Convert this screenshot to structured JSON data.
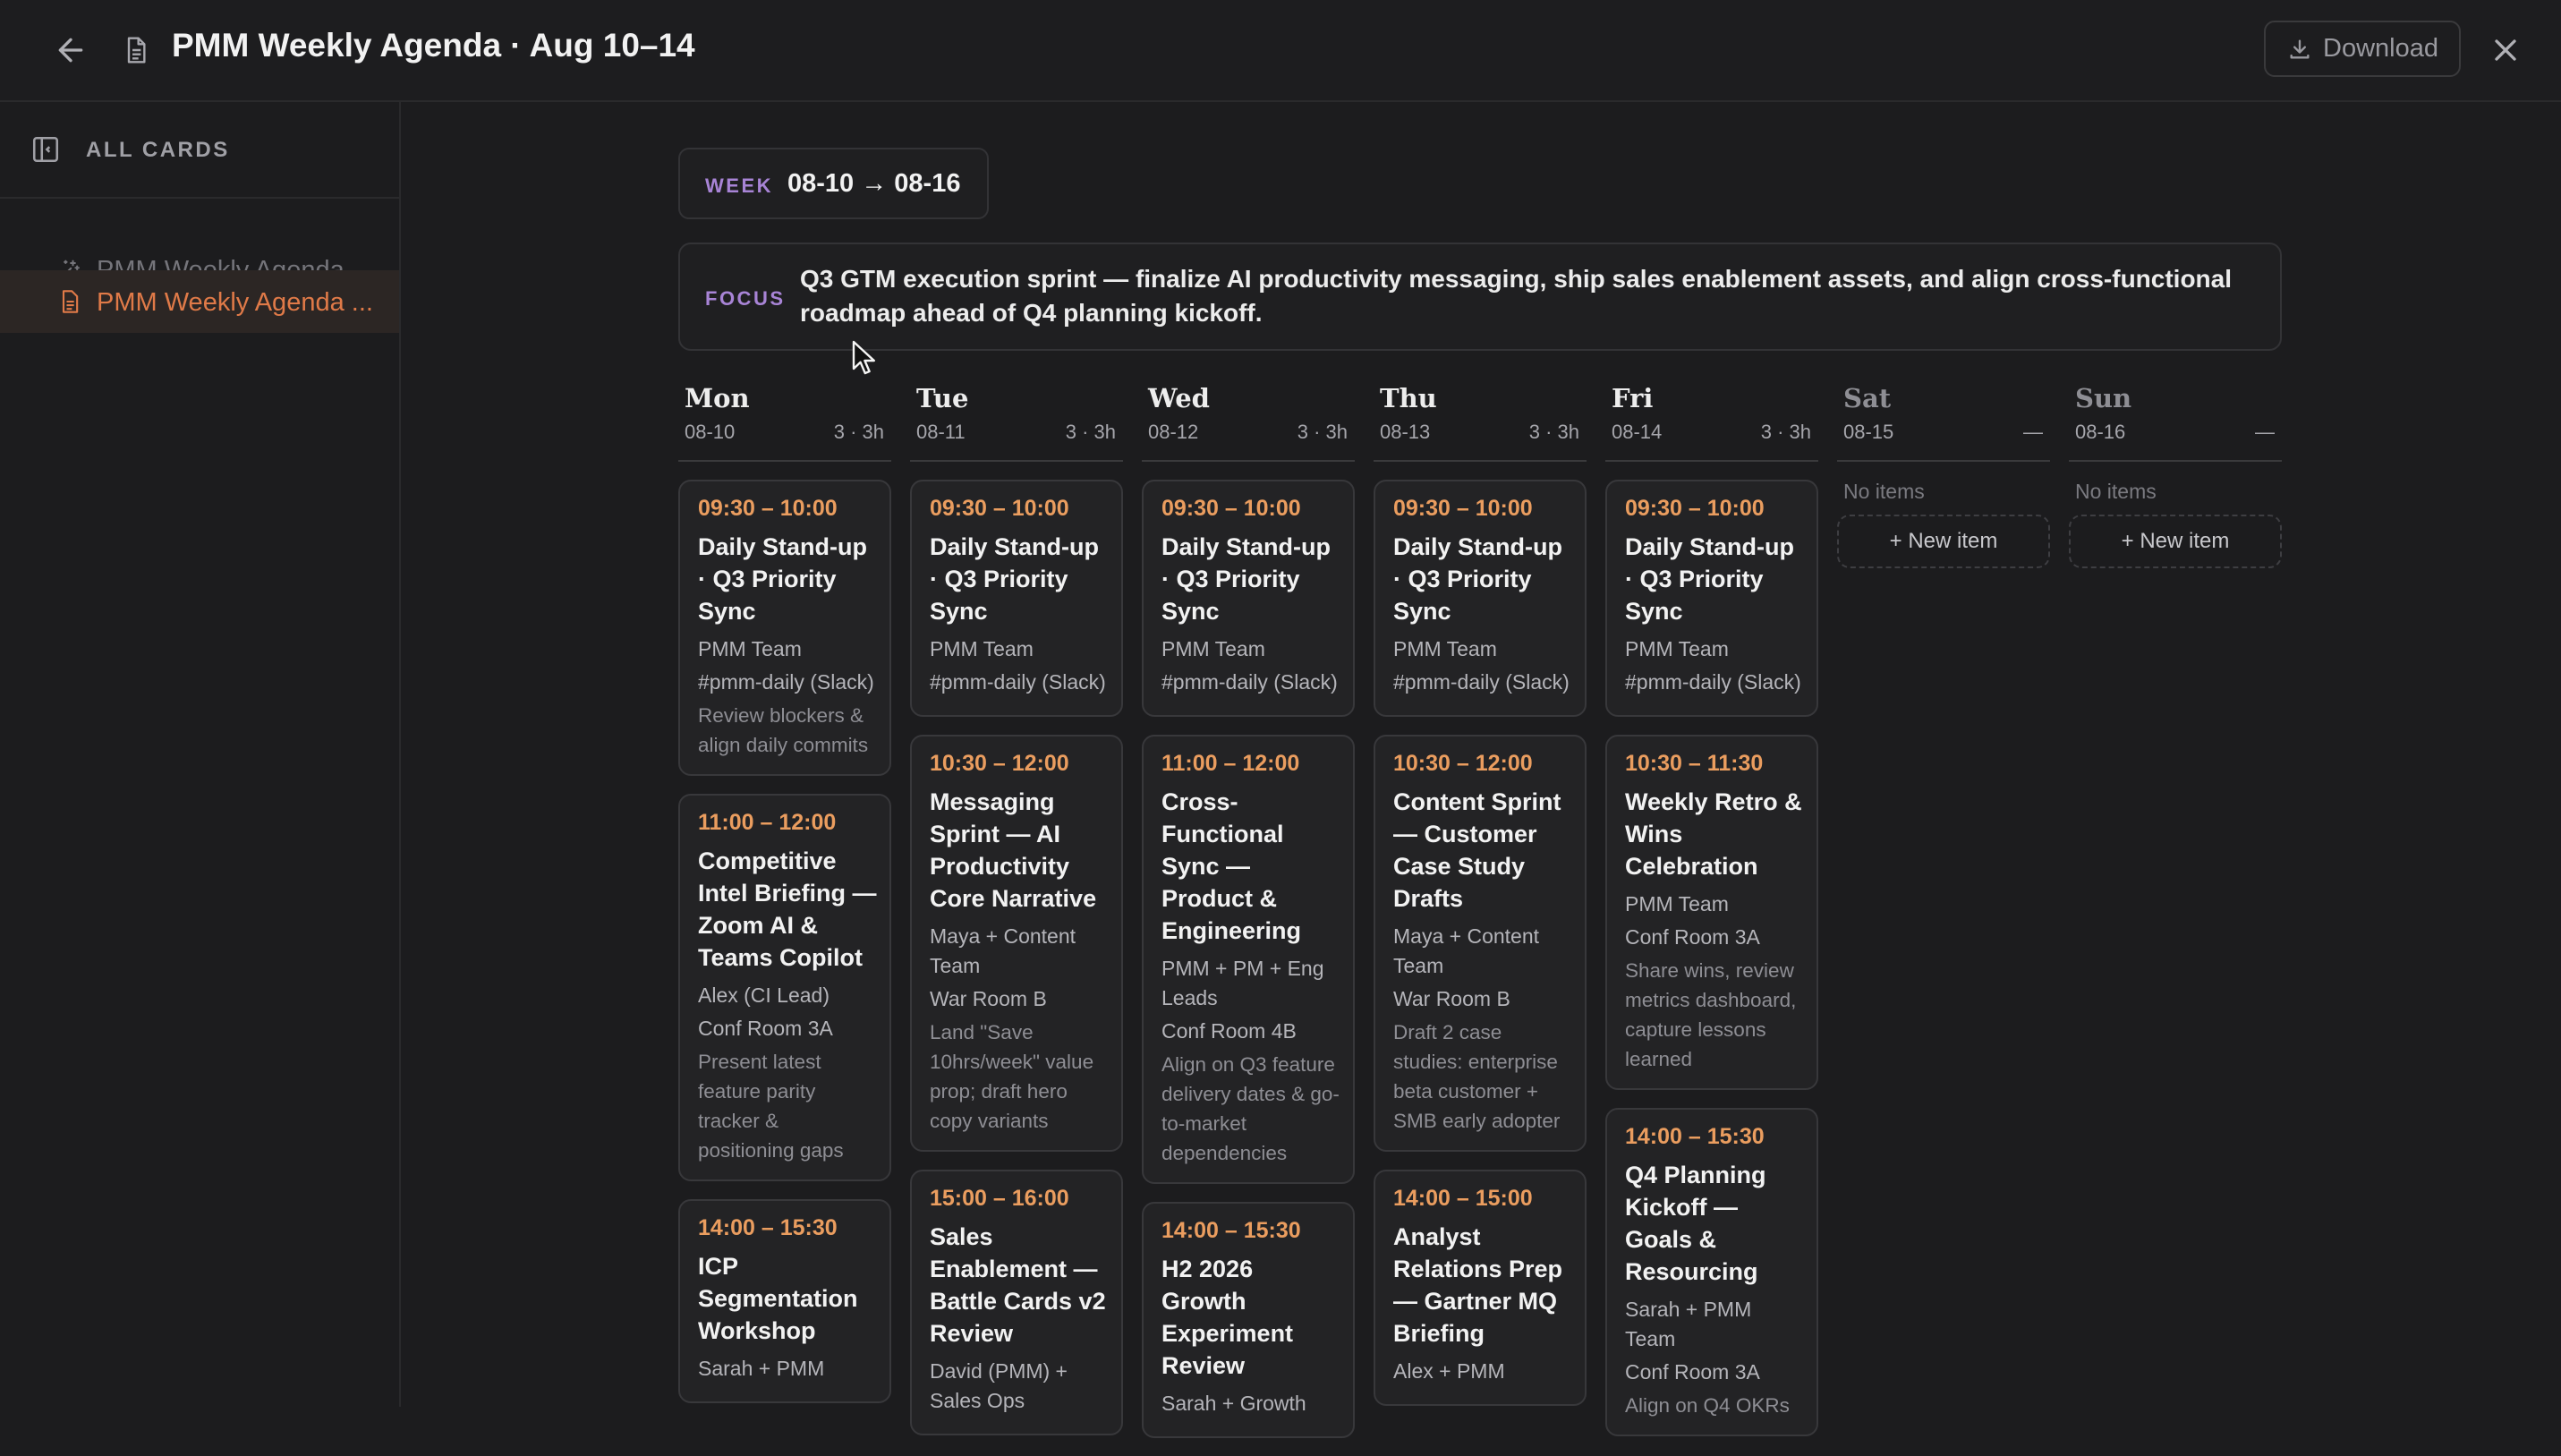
{
  "header": {
    "title": "PMM Weekly Agenda · Aug 10–14",
    "download_label": "Download"
  },
  "sidebar": {
    "heading": "ALL CARDS",
    "items": [
      {
        "label": "PMM Weekly Agenda ...",
        "icon": "sparkle-icon"
      },
      {
        "label": "PMM Weekly Agenda ...",
        "icon": "document-icon",
        "active": true
      }
    ]
  },
  "week": {
    "key": "WEEK",
    "range": "08-10 → 08-16"
  },
  "focus": {
    "key": "FOCUS",
    "text": "Q3 GTM execution sprint — finalize AI productivity messaging, ship sales enablement assets, and align cross-functional roadmap ahead of Q4 planning kickoff."
  },
  "days": [
    {
      "name": "Mon",
      "date": "08-10",
      "meta": "3 · 3h",
      "cards": [
        {
          "time": "09:30 – 10:00",
          "title": "Daily Stand-up · Q3 Priority Sync",
          "who": "PMM Team",
          "where": "#pmm-daily (Slack)",
          "note": "Review blockers & align daily commits"
        },
        {
          "time": "11:00 – 12:00",
          "title": "Competitive Intel Briefing — Zoom AI & Teams Copilot",
          "who": "Alex (CI Lead)",
          "where": "Conf Room 3A",
          "note": "Present latest feature parity tracker & positioning gaps"
        },
        {
          "time": "14:00 – 15:30",
          "title": "ICP Segmentation Workshop",
          "who": "Sarah + PMM",
          "where": "",
          "note": ""
        }
      ]
    },
    {
      "name": "Tue",
      "date": "08-11",
      "meta": "3 · 3h",
      "cards": [
        {
          "time": "09:30 – 10:00",
          "title": "Daily Stand-up · Q3 Priority Sync",
          "who": "PMM Team",
          "where": "#pmm-daily (Slack)",
          "note": ""
        },
        {
          "time": "10:30 – 12:00",
          "title": "Messaging Sprint — AI Productivity Core Narrative",
          "who": "Maya + Content Team",
          "where": "War Room B",
          "note": "Land \"Save 10hrs/week\" value prop; draft hero copy variants"
        },
        {
          "time": "15:00 – 16:00",
          "title": "Sales Enablement — Battle Cards v2 Review",
          "who": "David (PMM) + Sales Ops",
          "where": "",
          "note": ""
        }
      ]
    },
    {
      "name": "Wed",
      "date": "08-12",
      "meta": "3 · 3h",
      "cards": [
        {
          "time": "09:30 – 10:00",
          "title": "Daily Stand-up · Q3 Priority Sync",
          "who": "PMM Team",
          "where": "#pmm-daily (Slack)",
          "note": ""
        },
        {
          "time": "11:00 – 12:00",
          "title": "Cross-Functional Sync — Product & Engineering",
          "who": "PMM + PM + Eng Leads",
          "where": "Conf Room 4B",
          "note": "Align on Q3 feature delivery dates & go-to-market dependencies"
        },
        {
          "time": "14:00 – 15:30",
          "title": "H2 2026 Growth Experiment Review",
          "who": "Sarah + Growth",
          "where": "",
          "note": ""
        }
      ]
    },
    {
      "name": "Thu",
      "date": "08-13",
      "meta": "3 · 3h",
      "cards": [
        {
          "time": "09:30 – 10:00",
          "title": "Daily Stand-up · Q3 Priority Sync",
          "who": "PMM Team",
          "where": "#pmm-daily (Slack)",
          "note": ""
        },
        {
          "time": "10:30 – 12:00",
          "title": "Content Sprint — Customer Case Study Drafts",
          "who": "Maya + Content Team",
          "where": "War Room B",
          "note": "Draft 2 case studies: enterprise beta customer + SMB early adopter"
        },
        {
          "time": "14:00 – 15:00",
          "title": "Analyst Relations Prep — Gartner MQ Briefing",
          "who": "Alex + PMM",
          "where": "",
          "note": ""
        }
      ]
    },
    {
      "name": "Fri",
      "date": "08-14",
      "meta": "3 · 3h",
      "cards": [
        {
          "time": "09:30 – 10:00",
          "title": "Daily Stand-up · Q3 Priority Sync",
          "who": "PMM Team",
          "where": "#pmm-daily (Slack)",
          "note": ""
        },
        {
          "time": "10:30 – 11:30",
          "title": "Weekly Retro & Wins Celebration",
          "who": "PMM Team",
          "where": "Conf Room 3A",
          "note": "Share wins, review metrics dashboard, capture lessons learned"
        },
        {
          "time": "14:00 – 15:30",
          "title": "Q4 Planning Kickoff — Goals & Resourcing",
          "who": "Sarah + PMM Team",
          "where": "Conf Room 3A",
          "note": "Align on Q4 OKRs"
        }
      ]
    },
    {
      "name": "Sat",
      "date": "08-15",
      "meta": "—",
      "empty": "No items",
      "new_item": "+ New item",
      "cards": []
    },
    {
      "name": "Sun",
      "date": "08-16",
      "meta": "—",
      "empty": "No items",
      "new_item": "+ New item",
      "cards": []
    }
  ]
}
